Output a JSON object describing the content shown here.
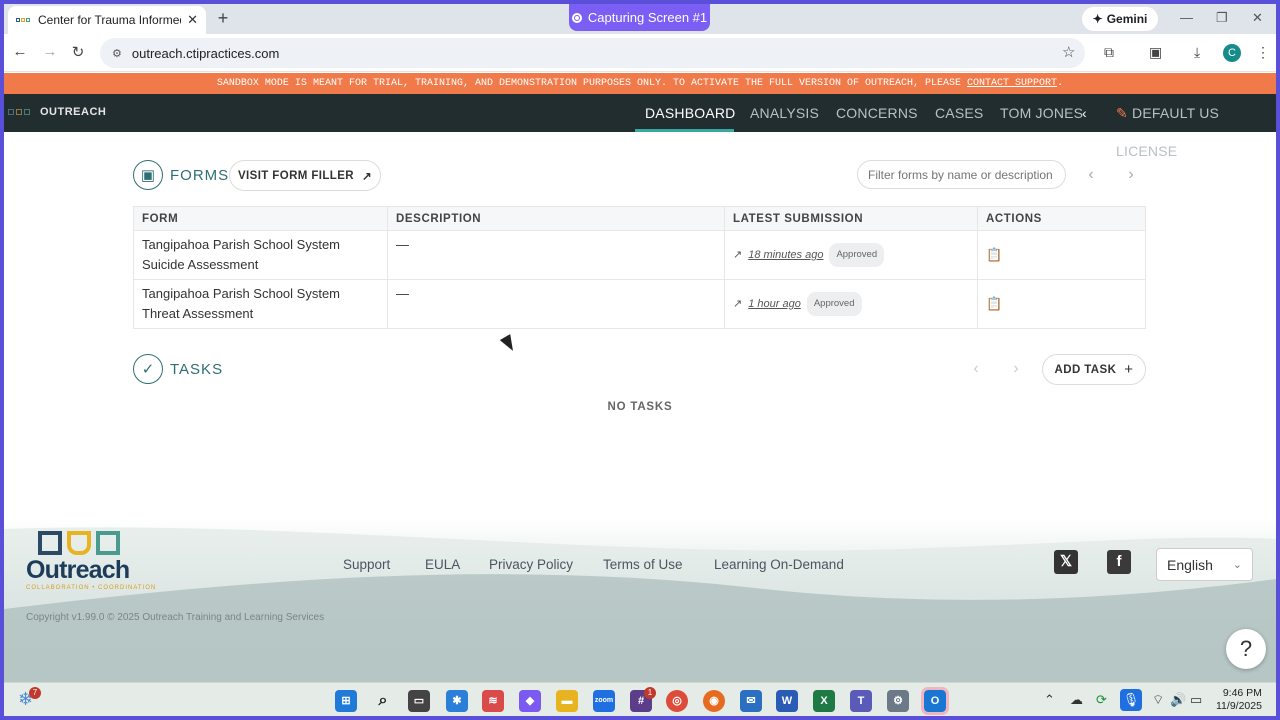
{
  "browser": {
    "tab_title": "Center for Trauma Informed Pra",
    "new_tab": "+",
    "capture_label": "Capturing Screen #1",
    "gemini_label": "Gemini",
    "url": "outreach.ctipractices.com",
    "profile_initial": "C"
  },
  "banner": {
    "text": "SANDBOX MODE IS MEANT FOR TRIAL, TRAINING, AND DEMONSTRATION PURPOSES ONLY. TO ACTIVATE THE FULL VERSION OF OUTREACH, PLEASE ",
    "link": "CONTACT SUPPORT",
    "end": "."
  },
  "appnav": {
    "brand": "OUTREACH",
    "links": [
      "DASHBOARD",
      "ANALYSIS",
      "CONCERNS",
      "CASES",
      "TOM JONES"
    ],
    "license": "DEFAULT US LICENSE"
  },
  "forms": {
    "title": "FORMS",
    "visit_button": "VISIT FORM FILLER",
    "filter_placeholder": "Filter forms by name or description",
    "columns": [
      "FORM",
      "DESCRIPTION",
      "LATEST SUBMISSION",
      "ACTIONS"
    ],
    "rows": [
      {
        "name": "Tangipahoa Parish School System Suicide Assessment",
        "description": "—",
        "time": "18 minutes ago",
        "status": "Approved"
      },
      {
        "name": "Tangipahoa Parish School System Threat Assessment",
        "description": "—",
        "time": "1 hour ago",
        "status": "Approved"
      }
    ]
  },
  "tasks": {
    "title": "TASKS",
    "add_button": "ADD TASK",
    "empty": "NO TASKS"
  },
  "footer": {
    "logo_word": "Outreach",
    "logo_tag": "COLLABORATION • COORDINATION",
    "links": [
      "Support",
      "EULA",
      "Privacy Policy",
      "Terms of Use",
      "Learning On-Demand"
    ],
    "copyright": "Copyright v1.99.0 © 2025 Outreach Training and Learning Services",
    "language": "English",
    "help": "?"
  },
  "taskbar": {
    "weather_badge": "7",
    "teams_badge": "1",
    "time": "9:46 PM",
    "date": "11/9/2025"
  }
}
